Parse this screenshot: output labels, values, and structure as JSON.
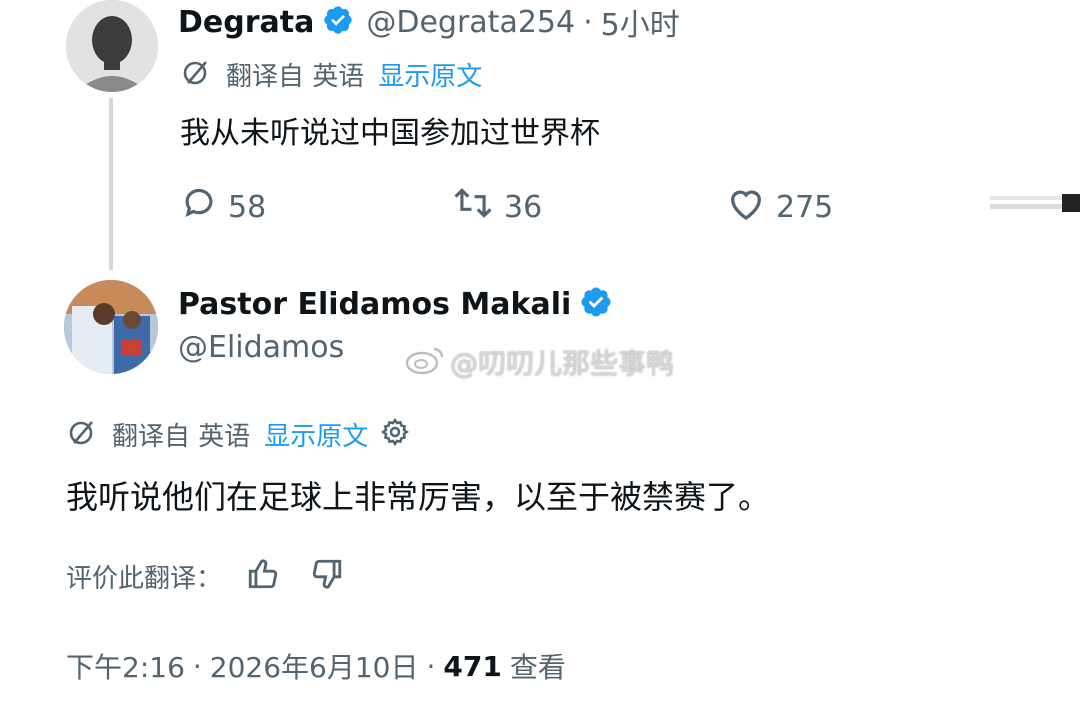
{
  "tweet1": {
    "display_name": "Degrata",
    "handle": "@Degrata254",
    "dot": "·",
    "time": "5小时",
    "translate": {
      "label": "翻译自 英语",
      "show_original": "显示原文"
    },
    "text": "我从未听说过中国参加过世界杯",
    "actions": {
      "replies": "58",
      "reposts": "36",
      "likes": "275"
    }
  },
  "tweet2": {
    "display_name": "Pastor Elidamos Makali",
    "handle": "@Elidamos",
    "translate": {
      "label": "翻译自 英语",
      "show_original": "显示原文"
    },
    "text": "我听说他们在足球上非常厉害，以至于被禁赛了。",
    "rate_translation": "评价此翻译：",
    "meta": {
      "time": "下午2:16",
      "sep1": "·",
      "date": "2026年6月10日",
      "sep2": "·",
      "views_count": "471",
      "views_label": "查看"
    }
  },
  "watermark": "@叨叨儿那些事鸭",
  "icons": [
    "translate-icon",
    "verified-badge-icon",
    "reply-icon",
    "repost-icon",
    "like-icon",
    "settings-gear-icon",
    "thumbs-up-icon",
    "thumbs-down-icon",
    "weibo-icon"
  ],
  "colors": {
    "verified": "#1d9bf0",
    "link": "#1d9bf0",
    "muted": "#536471",
    "text": "#0f1419"
  }
}
